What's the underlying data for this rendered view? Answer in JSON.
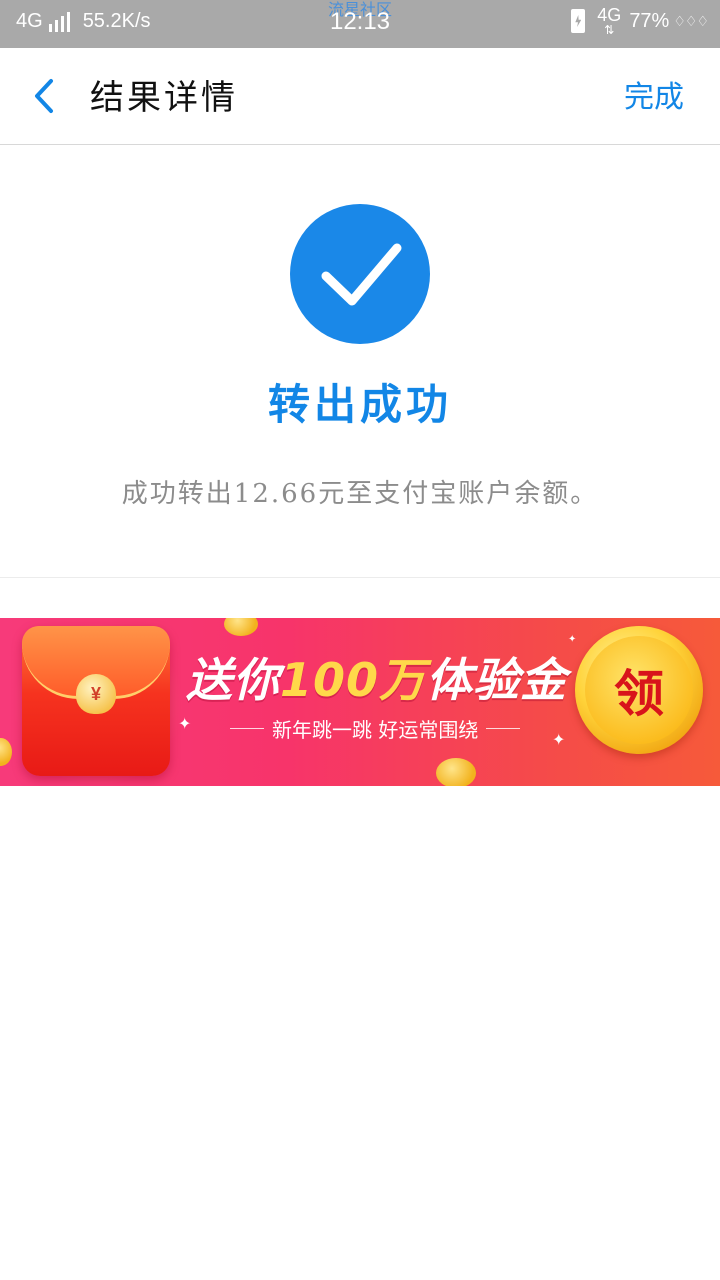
{
  "status_bar": {
    "network_left": "4G",
    "speed": "55.2K/s",
    "watermark": "流星社区",
    "time": "12:13",
    "network_right": "4G",
    "battery": "77%"
  },
  "nav": {
    "title": "结果详情",
    "done_label": "完成",
    "back_icon": "chevron-left-icon"
  },
  "result": {
    "title": "转出成功",
    "description": "成功转出12.66元至支付宝账户余额。",
    "icon": "check-circle-icon"
  },
  "banner": {
    "title_prefix": "送你",
    "title_highlight": "100万",
    "title_suffix": "体验金",
    "subtitle": "新年跳一跳 好运常围绕",
    "claim_label": "领",
    "bag_symbol": "¥"
  },
  "colors": {
    "accent": "#1286e6",
    "status_bar": "#a9a9a9",
    "banner_gradient_start": "#f73a7a",
    "banner_gradient_end": "#f65a3a"
  }
}
